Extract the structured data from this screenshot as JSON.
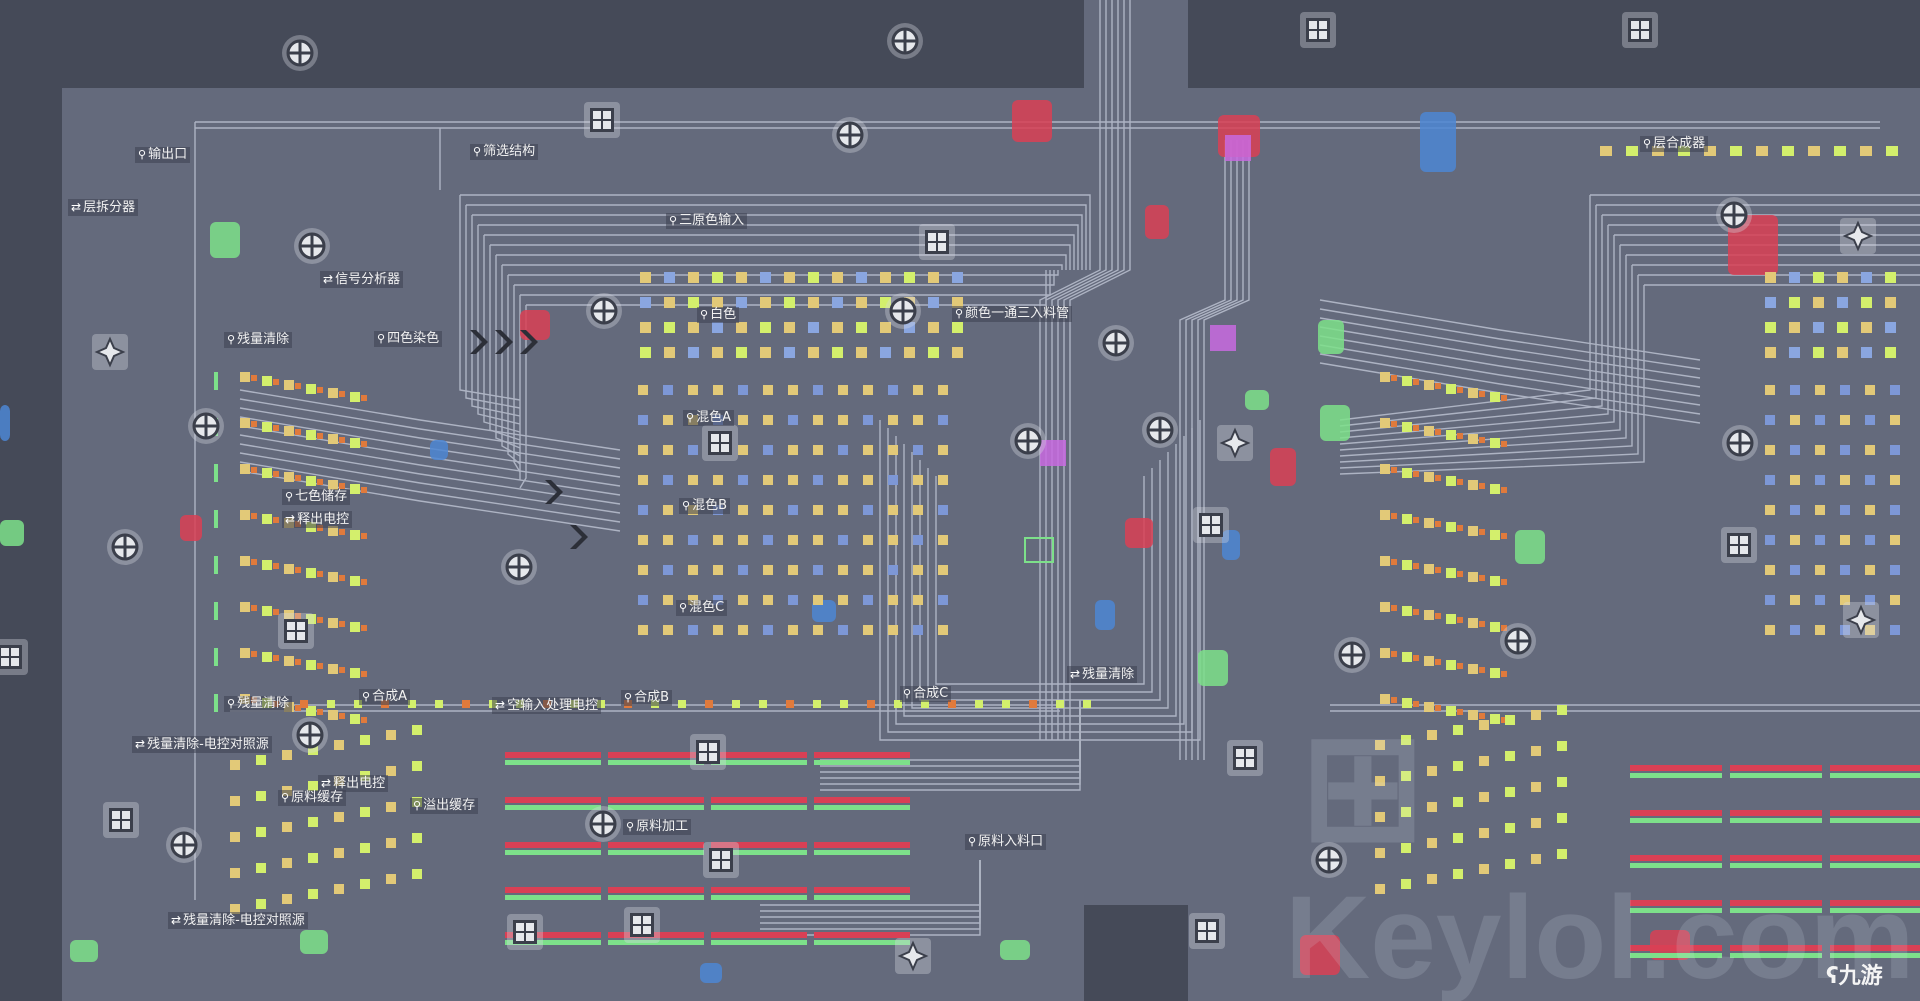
{
  "map": {
    "labels": [
      {
        "id": "output-port",
        "icon": "pin",
        "text": "输出口"
      },
      {
        "id": "filter-structure",
        "icon": "pin",
        "text": "筛选结构"
      },
      {
        "id": "layer-splitter",
        "icon": "swap",
        "text": "层拆分器"
      },
      {
        "id": "rgb-input",
        "icon": "pin",
        "text": "三原色输入"
      },
      {
        "id": "signal-analyzer",
        "icon": "swap",
        "text": "信号分析器"
      },
      {
        "id": "white",
        "icon": "pin",
        "text": "白色"
      },
      {
        "id": "color-pipe",
        "icon": "pin",
        "text": "颜色一通三入料管"
      },
      {
        "id": "residual-clear-1",
        "icon": "pin",
        "text": "残量清除"
      },
      {
        "id": "four-color-dye",
        "icon": "pin",
        "text": "四色染色"
      },
      {
        "id": "layer-combiner",
        "icon": "pin",
        "text": "层合成器"
      },
      {
        "id": "mix-a",
        "icon": "pin",
        "text": "混色A"
      },
      {
        "id": "mix-b",
        "icon": "pin",
        "text": "混色B"
      },
      {
        "id": "mix-c",
        "icon": "pin",
        "text": "混色C"
      },
      {
        "id": "seven-color-storage",
        "icon": "pin",
        "text": "七色储存"
      },
      {
        "id": "release-control-1",
        "icon": "swap",
        "text": "释出电控"
      },
      {
        "id": "residual-clear-2",
        "icon": "swap",
        "text": "残量清除"
      },
      {
        "id": "residual-clear-3",
        "icon": "pin",
        "text": "残量清除"
      },
      {
        "id": "synth-a",
        "icon": "pin",
        "text": "合成A"
      },
      {
        "id": "empty-input-ctrl",
        "icon": "swap",
        "text": "空输入处理电控"
      },
      {
        "id": "synth-b",
        "icon": "pin",
        "text": "合成B"
      },
      {
        "id": "synth-c",
        "icon": "pin",
        "text": "合成C"
      },
      {
        "id": "residual-ctrl-ref-1",
        "icon": "swap",
        "text": "残量清除-电控对照源"
      },
      {
        "id": "release-control-2",
        "icon": "swap",
        "text": "释出电控"
      },
      {
        "id": "raw-buffer",
        "icon": "pin",
        "text": "原料缓存"
      },
      {
        "id": "overflow-buffer",
        "icon": "pin",
        "text": "溢出缓存"
      },
      {
        "id": "raw-processing",
        "icon": "pin",
        "text": "原料加工"
      },
      {
        "id": "raw-inlet",
        "icon": "pin",
        "text": "原料入料口"
      },
      {
        "id": "residual-ctrl-ref-2",
        "icon": "swap",
        "text": "残量清除-电控对照源"
      }
    ]
  },
  "watermark": {
    "brand": "Keylol.com",
    "logo": "九游"
  },
  "colors": {
    "background": "#454a58",
    "floor": "#646a7c",
    "wire": "#b6bccb",
    "yellow": "#e2c978",
    "lime": "#d3ef6c",
    "orange": "#e07a3c",
    "green": "#7de08a",
    "red": "#d94055",
    "blue": "#4c86d4",
    "purple": "#c86ae0"
  }
}
